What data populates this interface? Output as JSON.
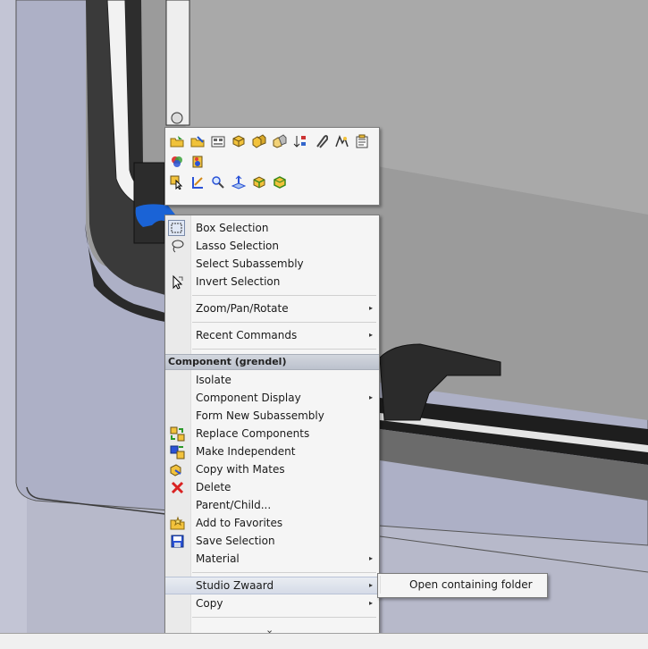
{
  "toolbar": {
    "row1_icons": [
      "open-part-icon",
      "edit-part-icon",
      "component-properties-icon",
      "hide-component-icon",
      "change-transparency-icon",
      "mate-icon",
      "sort-icon",
      "attach-icon",
      "smart-mate-icon",
      "properties-icon"
    ],
    "row2_icons": [
      "appearance-icon",
      "color-palette-icon"
    ],
    "row3_icons": [
      "select-icon",
      "sketch-icon",
      "zoom-to-selection-icon",
      "normal-to-icon",
      "view-orientation-icon",
      "view-shaded-icon"
    ]
  },
  "menu": {
    "selection_tools": [
      {
        "label": "Box Selection",
        "icon": "box-selection-icon"
      },
      {
        "label": "Lasso Selection",
        "icon": "lasso-selection-icon"
      },
      {
        "label": "Select Subassembly",
        "icon": ""
      },
      {
        "label": "Invert Selection",
        "icon": "invert-selection-icon"
      }
    ],
    "zoom_pan_rotate": "Zoom/Pan/Rotate",
    "recent_commands": "Recent Commands",
    "section_header": "Component (grendel)",
    "component_items": [
      {
        "label": "Isolate",
        "icon": "",
        "submenu": false
      },
      {
        "label": "Component Display",
        "icon": "",
        "submenu": true
      },
      {
        "label": "Form New Subassembly",
        "icon": "",
        "submenu": false
      },
      {
        "label": "Replace Components",
        "icon": "replace-components-icon",
        "submenu": false
      },
      {
        "label": "Make Independent",
        "icon": "make-independent-icon",
        "submenu": false
      },
      {
        "label": "Copy with Mates",
        "icon": "copy-with-mates-icon",
        "submenu": false
      },
      {
        "label": "Delete",
        "icon": "delete-icon",
        "submenu": false
      },
      {
        "label": "Parent/Child...",
        "icon": "",
        "submenu": false
      },
      {
        "label": "Add to Favorites",
        "icon": "add-to-favorites-icon",
        "submenu": false
      },
      {
        "label": "Save Selection",
        "icon": "save-selection-icon",
        "submenu": false
      },
      {
        "label": "Material",
        "icon": "",
        "submenu": true
      }
    ],
    "studio_zwaard": "Studio Zwaard",
    "copy": "Copy",
    "more_glyph": "⌄",
    "submenu_arrow": "▸"
  },
  "submenu": {
    "open_containing_folder": "Open containing folder"
  },
  "colors": {
    "menu_bg": "#f5f5f5",
    "header_bg": "#c4c9d3",
    "highlight": "#dde2ec",
    "model_bg": "#9c9c9c",
    "floor": "#b7b9ca",
    "delete_red": "#d92222"
  }
}
